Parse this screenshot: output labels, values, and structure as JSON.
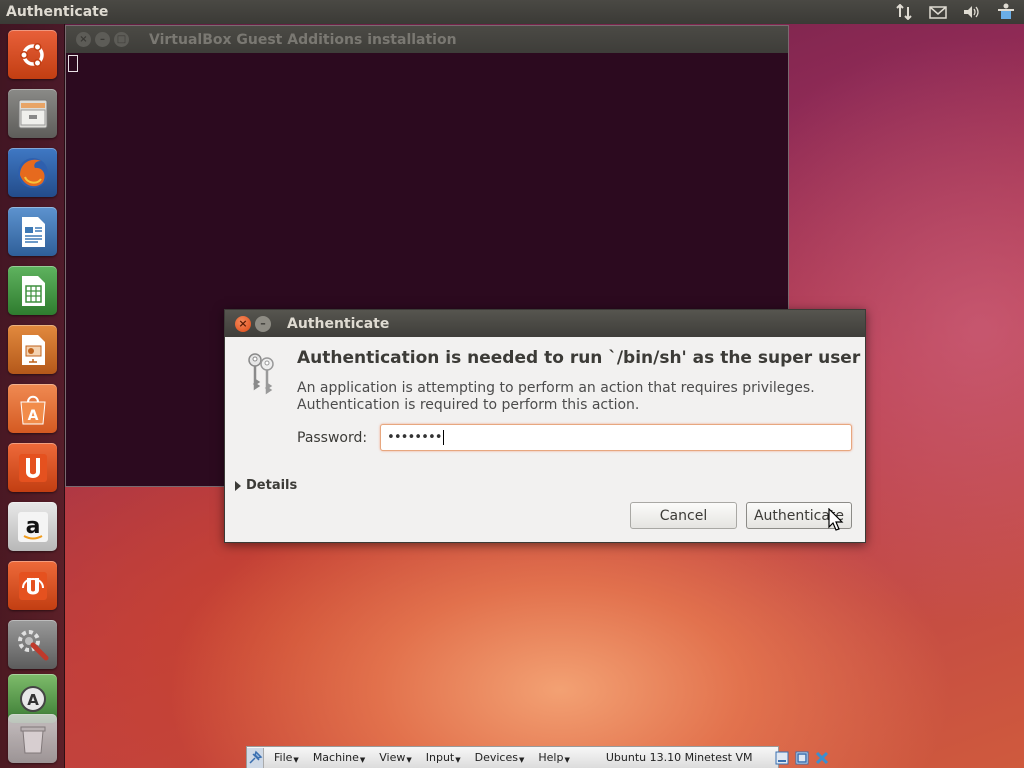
{
  "top_panel": {
    "title": "Authenticate",
    "indicators": [
      "network-icon",
      "mail-icon",
      "volume-icon",
      "accessibility-icon"
    ]
  },
  "launcher": {
    "items": [
      {
        "name": "ubuntu-dash",
        "color": "#dd4814"
      },
      {
        "name": "files",
        "color": "#a7a7a4"
      },
      {
        "name": "firefox",
        "color": "#c54a23"
      },
      {
        "name": "libreoffice-writer",
        "color": "#3d79b6"
      },
      {
        "name": "libreoffice-calc",
        "color": "#3d8f3d"
      },
      {
        "name": "libreoffice-impress",
        "color": "#c0631c"
      },
      {
        "name": "ubuntu-software-center",
        "color": "#e5632e"
      },
      {
        "name": "ubuntu-one",
        "color": "#dd4814"
      },
      {
        "name": "amazon",
        "color": "#c9c9c9"
      },
      {
        "name": "ubuntu-one-music",
        "color": "#dd4814"
      },
      {
        "name": "system-settings",
        "color": "#a84a3a"
      },
      {
        "name": "software-updater",
        "color": "#4a9a4a"
      },
      {
        "name": "trash",
        "color": "#d0d0d0"
      }
    ]
  },
  "terminal": {
    "title": "VirtualBox Guest Additions installation"
  },
  "dialog": {
    "title": "Authenticate",
    "heading": "Authentication is needed to run `/bin/sh' as the super user",
    "message_line1": "An application is attempting to perform an action that requires privileges.",
    "message_line2": "Authentication is required to perform this action.",
    "password_label": "Password:",
    "password_value": "••••••••",
    "details_label": "Details",
    "cancel_label": "Cancel",
    "authenticate_label": "Authenticate"
  },
  "vbox_bar": {
    "menus": [
      "File",
      "Machine",
      "View",
      "Input",
      "Devices",
      "Help"
    ],
    "vm_name": "Ubuntu 13.10 Minetest VM"
  }
}
